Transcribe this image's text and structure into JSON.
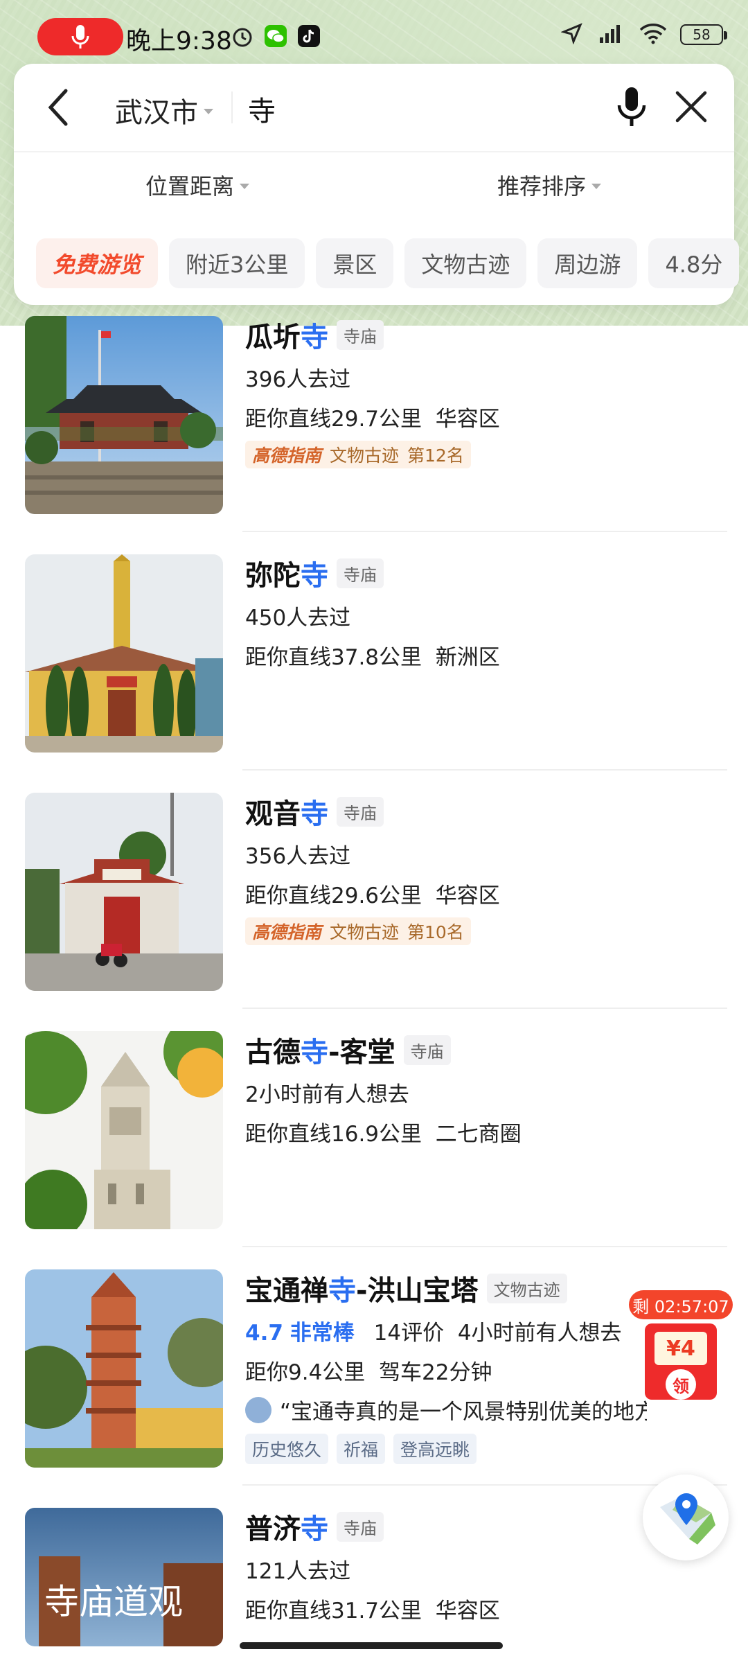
{
  "status_bar": {
    "time": "晚上9:38",
    "battery": "58"
  },
  "search": {
    "city": "武汉市",
    "query": "寺"
  },
  "filters": {
    "distance": "位置距离",
    "sort": "推荐排序"
  },
  "chips": [
    "免费游览",
    "附近3公里",
    "景区",
    "文物古迹",
    "周边游",
    "4.8分"
  ],
  "results": [
    {
      "name_pre": "瓜圻",
      "name_hl": "寺",
      "name_post": "",
      "category": "寺庙",
      "visits": "396人去过",
      "distance": "距你直线29.7公里",
      "area": "华容区",
      "guide": {
        "brand": "高德指南",
        "type": "文物古迹",
        "rank": "第12名"
      }
    },
    {
      "name_pre": "弥陀",
      "name_hl": "寺",
      "name_post": "",
      "category": "寺庙",
      "visits": "450人去过",
      "distance": "距你直线37.8公里",
      "area": "新洲区"
    },
    {
      "name_pre": "观音",
      "name_hl": "寺",
      "name_post": "",
      "category": "寺庙",
      "visits": "356人去过",
      "distance": "距你直线29.6公里",
      "area": "华容区",
      "guide": {
        "brand": "高德指南",
        "type": "文物古迹",
        "rank": "第10名"
      }
    },
    {
      "name_pre": "古德",
      "name_hl": "寺",
      "name_post": "-客堂",
      "category": "寺庙",
      "visits": "2小时前有人想去",
      "distance": "距你直线16.9公里",
      "area": "二七商圈"
    },
    {
      "name_pre": "宝通禅",
      "name_hl": "寺",
      "name_post": "-洪山宝塔",
      "category": "文物古迹",
      "score": "4.7",
      "score_label": "非常棒",
      "reviews": "14评价",
      "recent": "4小时前有人想去",
      "distance": "距你9.4公里",
      "drive": "驾车22分钟",
      "quote": "“宝通寺真的是一个风景特别优美的地方",
      "tags": [
        "历史悠久",
        "祈福",
        "登高远眺"
      ]
    },
    {
      "name_pre": "普济",
      "name_hl": "寺",
      "name_post": "",
      "category": "寺庙",
      "visits": "121人去过",
      "distance": "距你直线31.7公里",
      "area": "华容区",
      "thumb_caption": "寺庙道观"
    }
  ],
  "coupon": {
    "timer": "剩 02:57:07",
    "value": "¥4",
    "action": "领"
  },
  "colors": {
    "accent": "#2a6ef0",
    "hot": "#f24a2c",
    "record": "#ee2a2a"
  }
}
